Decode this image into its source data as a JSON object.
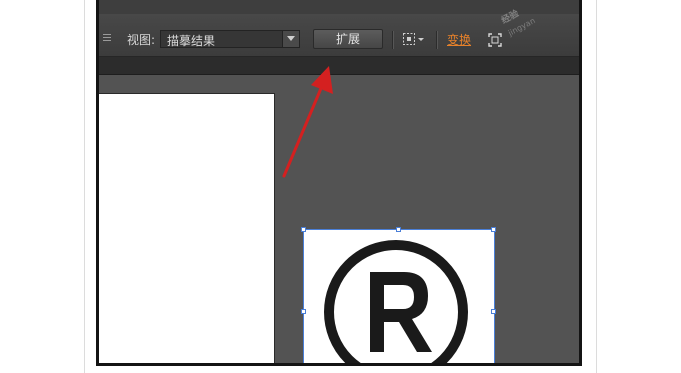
{
  "toolbar": {
    "view_label": "视图:",
    "view_select_value": "描摹结果",
    "expand_button": "扩展",
    "transform_link": "变换",
    "transform_color": "#e8822a"
  },
  "icons": [
    "menu-grip-icon",
    "chevron-down-icon",
    "align-grid-icon",
    "crop-corners-icon"
  ],
  "canvas": {
    "logo_mark": "R",
    "selection_color": "#4a7fd8"
  },
  "annotation": {
    "arrow_color": "#d42020"
  }
}
